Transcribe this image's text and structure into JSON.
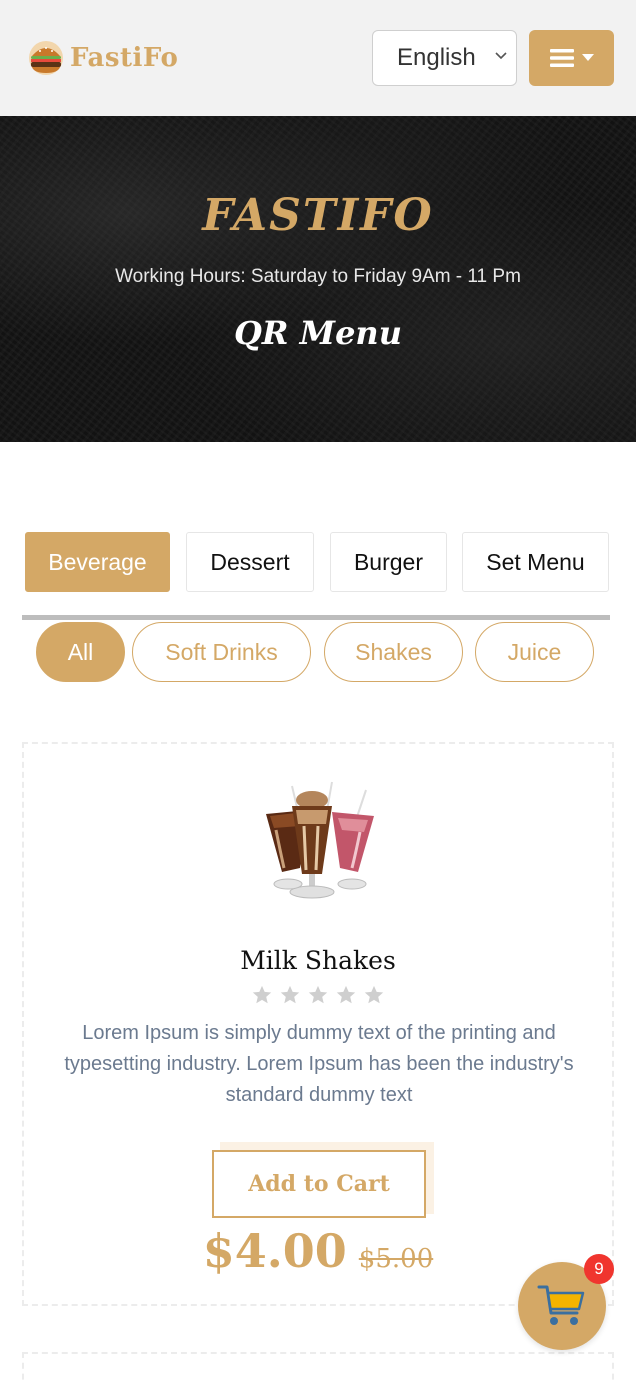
{
  "header": {
    "brand": "FastiFo",
    "language": {
      "selected": "English"
    },
    "menu_icon": "hamburger-menu-icon"
  },
  "hero": {
    "title": "FASTIFO",
    "hours": "Working Hours: Saturday to Friday 9Am - 11 Pm",
    "subtitle": "QR Menu"
  },
  "categories": [
    {
      "label": "Beverage",
      "active": true
    },
    {
      "label": "Dessert",
      "active": false
    },
    {
      "label": "Burger",
      "active": false
    },
    {
      "label": "Set Menu",
      "active": false
    }
  ],
  "filters": [
    {
      "label": "All",
      "active": true
    },
    {
      "label": "Soft Drinks",
      "active": false
    },
    {
      "label": "Shakes",
      "active": false
    },
    {
      "label": "Juice",
      "active": false
    }
  ],
  "product": {
    "name": "Milk Shakes",
    "rating": 0,
    "rating_max": 5,
    "description": "Lorem Ipsum is simply dummy text of the printing and typesetting industry. Lorem Ipsum has been the industry's standard dummy text",
    "add_to_cart": "Add to Cart",
    "price": "$4.00",
    "old_price": "$5.00"
  },
  "cart": {
    "count": "9",
    "icon": "shopping-cart-icon"
  },
  "colors": {
    "accent": "#d4a866",
    "badge": "#f0352e",
    "hero_bg": "#141414",
    "header_bg": "#f2f2f2"
  }
}
